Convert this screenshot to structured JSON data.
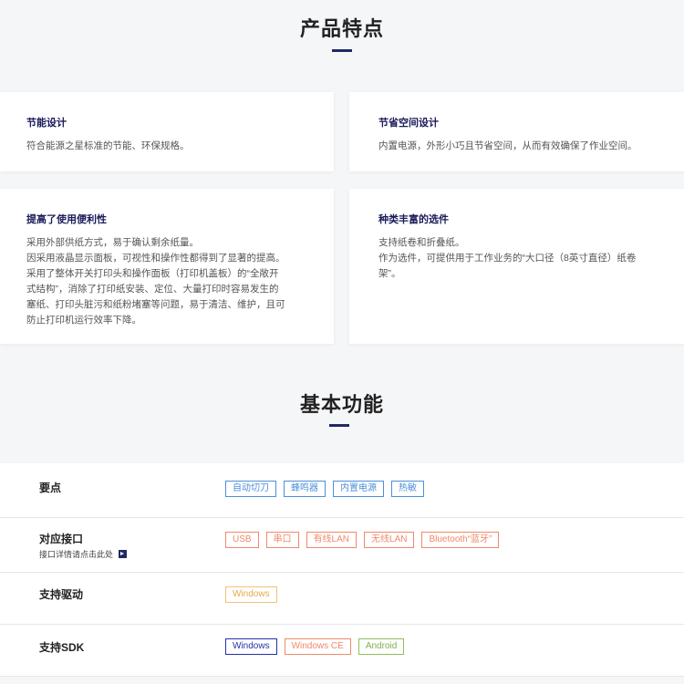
{
  "features": {
    "title": "产品特点",
    "cards": [
      {
        "title": "节能设计",
        "lines": [
          "符合能源之星标准的节能、环保规格。"
        ]
      },
      {
        "title": "节省空间设计",
        "lines": [
          "内置电源，外形小巧且节省空间，从而有效确保了作业空间。"
        ]
      },
      {
        "title": "提高了使用便利性",
        "lines": [
          "采用外部供纸方式，易于确认剩余纸量。",
          "因采用液晶显示面板，可视性和操作性都得到了显著的提高。",
          "采用了整体开关打印头和操作面板（打印机盖板）的“全敞开",
          "式结构”，消除了打印纸安装、定位、大量打印时容易发生的",
          "塞纸、打印头脏污和纸粉堵塞等问题，易于清洁、维护，且可",
          "防止打印机运行效率下降。"
        ]
      },
      {
        "title": "种类丰富的选件",
        "lines": [
          "支持纸卷和折叠纸。",
          "作为选件，可提供用于工作业务的“大口径（8英寸直径）纸卷",
          "架”。"
        ]
      }
    ]
  },
  "functions": {
    "title": "基本功能",
    "rows": {
      "points": {
        "label": "要点",
        "tags": [
          "自动切刀",
          "蜂鸣器",
          "内置电源",
          "热敏"
        ]
      },
      "interface": {
        "label": "对应接口",
        "sublink": "接口详情请点击此处",
        "tags": [
          "USB",
          "串口",
          "有线LAN",
          "无线LAN",
          "Bluetooth“蓝牙”"
        ]
      },
      "driver": {
        "label": "支持驱动",
        "tags": [
          "Windows"
        ]
      },
      "sdk": {
        "label": "支持SDK",
        "tags": [
          "Windows",
          "Windows CE",
          "Android"
        ]
      }
    }
  },
  "colors": {
    "accent_bar": "#1f2a63",
    "card_title": "#1a1a5a",
    "tag_blue": "#4a90d9",
    "tag_orange": "#f0896a",
    "tag_yellow": "#e6a94a",
    "tag_navy": "#2233aa",
    "tag_green": "#7fb04a"
  },
  "icons": {
    "interface_link": "arrow-right-square-icon"
  }
}
